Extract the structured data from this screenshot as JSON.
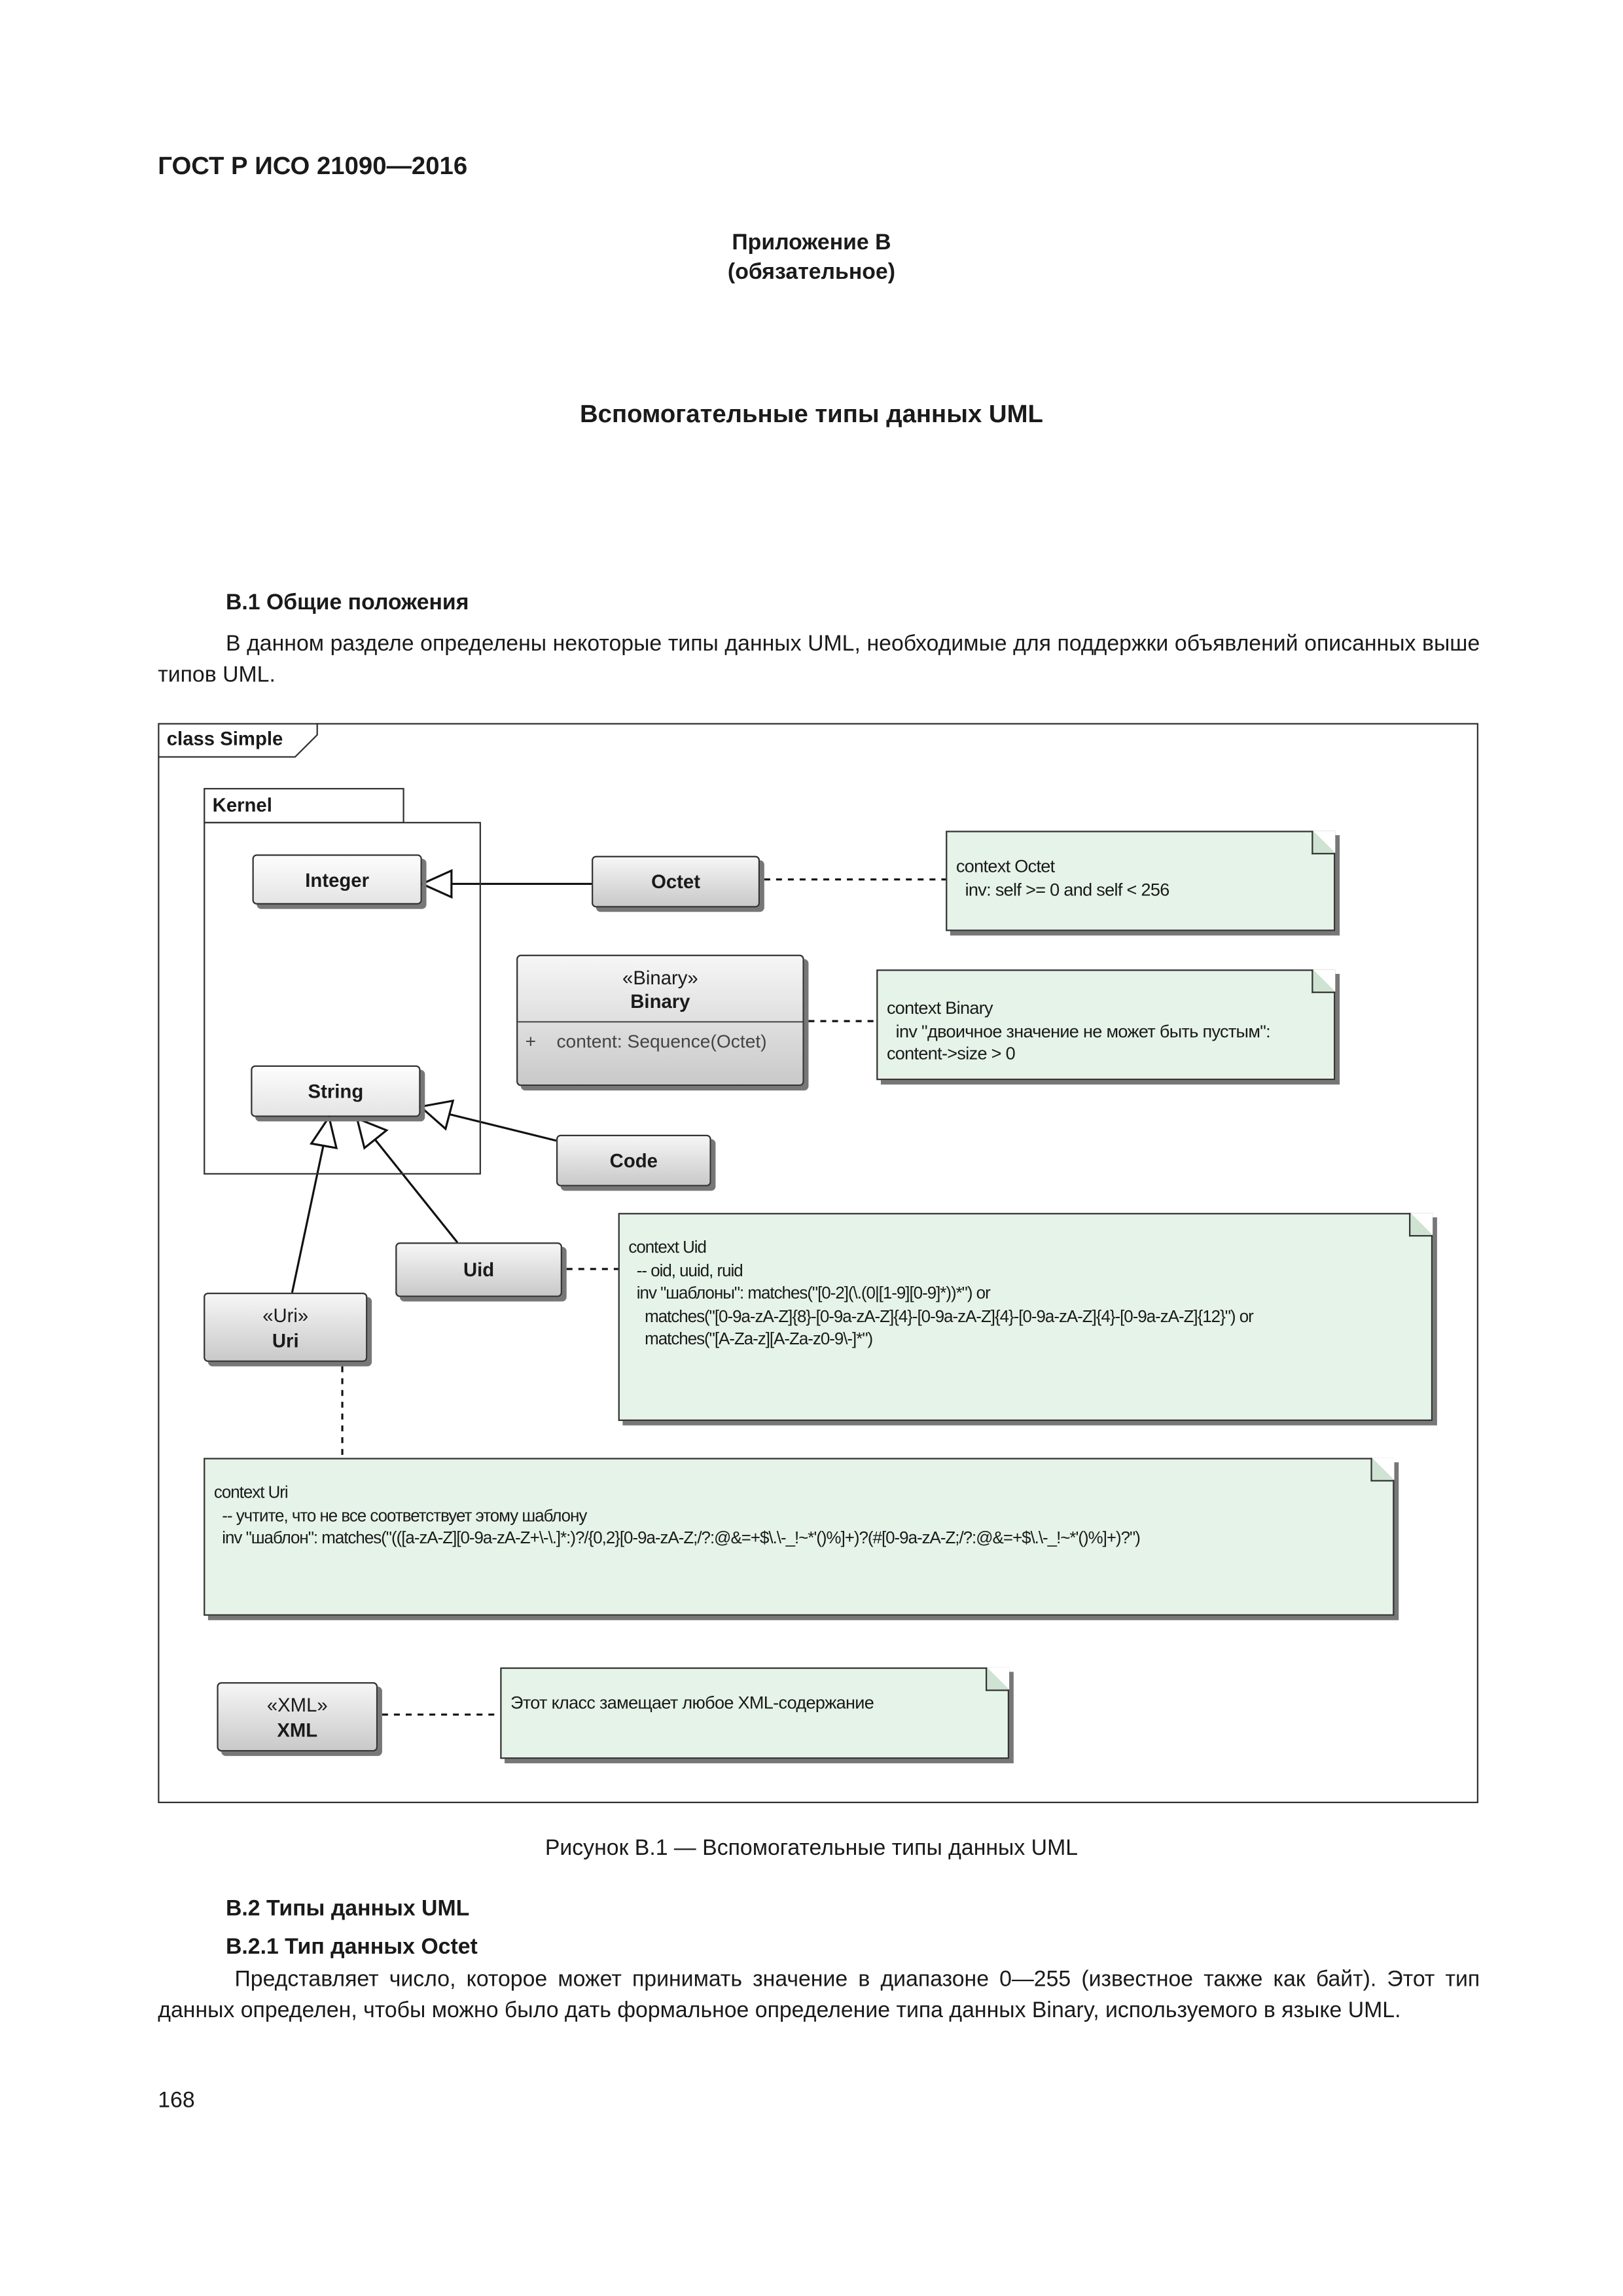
{
  "header": {
    "standard": "ГОСТ Р ИСО 21090—2016"
  },
  "annex": {
    "title": "Приложение B",
    "status": "(обязательное)",
    "heading": "Вспомогательные типы данных UML"
  },
  "section_b1": {
    "heading": "B.1 Общие положения",
    "text": "В данном разделе определены некоторые типы данных UML, необходимые для поддержки объявлений описанных выше типов UML."
  },
  "diagram": {
    "frame_label": "class Simple",
    "package": "Kernel",
    "classes": {
      "integer": "Integer",
      "string": "String",
      "octet": "Octet",
      "binary_stereotype": "«Binary»",
      "binary": "Binary",
      "binary_attr_visibility": "+",
      "binary_attr": "content: Sequence(Octet)",
      "code": "Code",
      "uid": "Uid",
      "uri_stereotype": "«Uri»",
      "uri": "Uri",
      "xml_stereotype": "«XML»",
      "xml": "XML"
    },
    "notes": {
      "octet": "context Octet\n  inv: self >= 0 and self < 256",
      "binary": "context Binary\n  inv \"двоичное значение не может быть пустым\":\ncontent->size > 0",
      "uid": "context Uid\n  -- oid, uuid, ruid\n  inv \"шаблоны\": matches(\"[0-2](\\.(0|[1-9][0-9]*))*\") or\n    matches(\"[0-9a-zA-Z]{8}-[0-9a-zA-Z]{4}-[0-9a-zA-Z]{4}-[0-9a-zA-Z]{4}-[0-9a-zA-Z]{12}\") or\n    matches(\"[A-Za-z][A-Za-z0-9\\-]*\")",
      "uri": "context Uri\n  -- учтите, что не все соответствует этому шаблону\n  inv \"шаблон\": matches(\"(([a-zA-Z][0-9a-zA-Z+\\-\\.]*:)?/{0,2}[0-9a-zA-Z;/?:@&=+$\\.\\-_!~*'()%]+)?(#[0-9a-zA-Z;/?:@&=+$\\.\\-_!~*'()%]+)?\")",
      "xml": "Этот класс замещает любое XML-содержание"
    },
    "colors": {
      "note": "#e6f3e8",
      "class": "#d9d9d9"
    }
  },
  "caption": "Рисунок B.1 — Вспомогательные типы данных UML",
  "section_b2": {
    "heading": "B.2 Типы данных UML"
  },
  "section_b21": {
    "heading": "B.2.1 Тип данных Octet",
    "text": "Представляет число, которое может принимать значение в диапазоне 0—255 (известное также как байт). Этот тип данных определен, чтобы можно было дать формальное определение типа данных Binary, используемого в языке UML."
  },
  "page_number": "168"
}
